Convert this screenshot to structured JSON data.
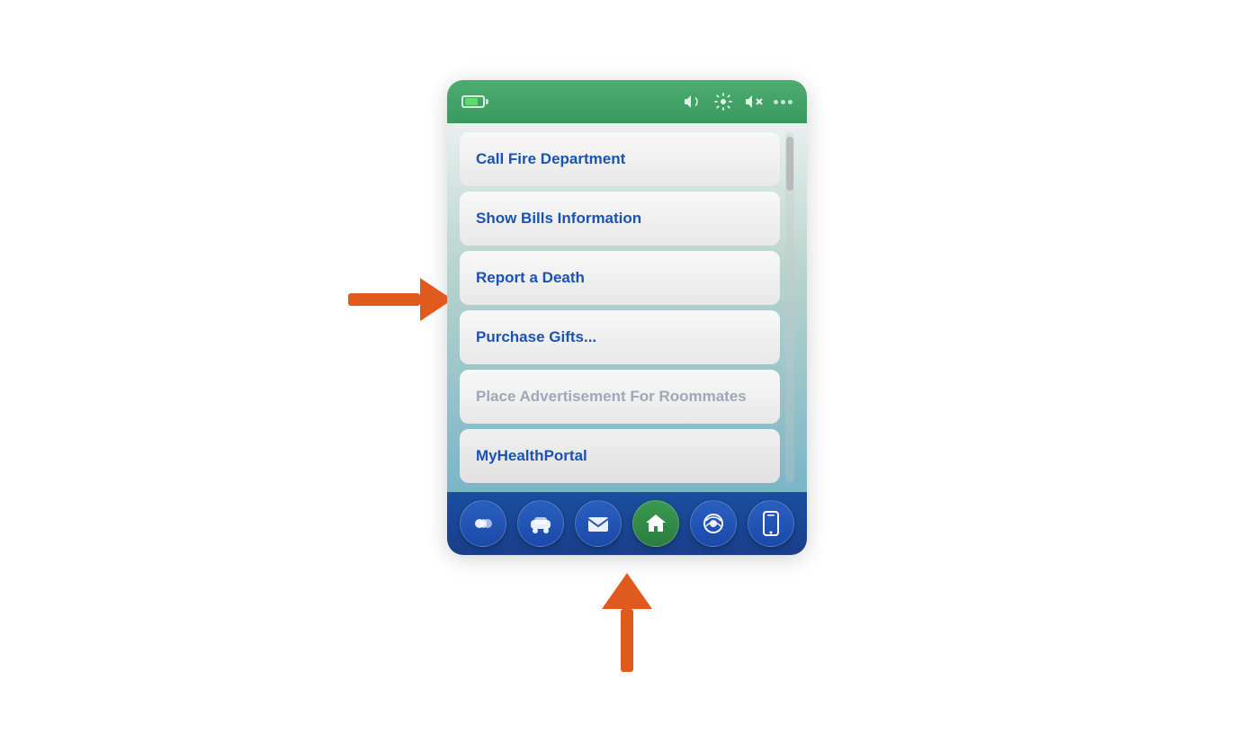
{
  "device": {
    "statusBar": {
      "batteryLabel": "battery",
      "speakerLabel": "speaker-icon",
      "settingsLabel": "settings-icon",
      "muteLabel": "mute-icon",
      "dotsLabel": "signal-dots"
    },
    "menu": {
      "items": [
        {
          "id": "call-fire",
          "label": "Call Fire Department",
          "enabled": true
        },
        {
          "id": "show-bills",
          "label": "Show Bills Information",
          "enabled": true
        },
        {
          "id": "report-death",
          "label": "Report a Death",
          "enabled": true
        },
        {
          "id": "purchase-gifts",
          "label": "Purchase Gifts...",
          "enabled": true
        },
        {
          "id": "place-ad",
          "label": "Place Advertisement For Roommates",
          "enabled": false
        },
        {
          "id": "health-portal",
          "label": "MyHealthPortal",
          "enabled": true
        }
      ]
    },
    "bottomNav": {
      "items": [
        {
          "id": "social",
          "icon": "💬",
          "active": false
        },
        {
          "id": "transport",
          "icon": "🚗",
          "active": false
        },
        {
          "id": "mail",
          "icon": "✉️",
          "active": false
        },
        {
          "id": "home",
          "icon": "🏠",
          "active": true
        },
        {
          "id": "music",
          "icon": "🔊",
          "active": false
        },
        {
          "id": "device",
          "icon": "📱",
          "active": false
        }
      ]
    }
  },
  "arrows": {
    "rightArrow": "pointing to Report a Death item",
    "upArrow": "pointing to bottom nav bar"
  }
}
